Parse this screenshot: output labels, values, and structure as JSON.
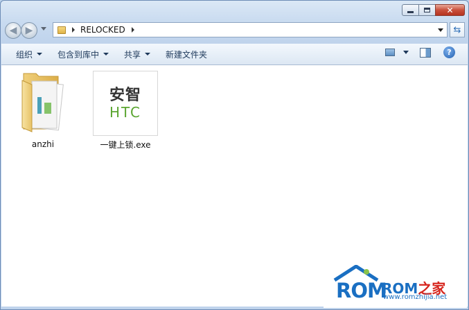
{
  "window": {
    "controls": {
      "minimize": "",
      "maximize": "",
      "close": "✕"
    }
  },
  "nav": {
    "back_glyph": "◀",
    "forward_glyph": "▶",
    "address": {
      "crumbs": [
        "RELOCKED"
      ]
    },
    "refresh_glyph": "⇆"
  },
  "toolbar": {
    "organize": "组织",
    "include_in_library": "包含到库中",
    "share": "共享",
    "new_folder": "新建文件夹",
    "help_glyph": "?"
  },
  "files": [
    {
      "name": "anzhi",
      "type": "folder"
    },
    {
      "name": "一键上锁.exe",
      "type": "exe",
      "thumb_text_cn": "安智",
      "thumb_text_logo": "HTC"
    }
  ],
  "colors": {
    "accent": "#1a6fc2",
    "htc_green": "#5aa530",
    "watermark_red": "#d6251d"
  },
  "watermark": {
    "logo_big": "ROM",
    "brand_rom": "ROM",
    "brand_cn": "之家",
    "url": "www.romzhijia.net"
  }
}
